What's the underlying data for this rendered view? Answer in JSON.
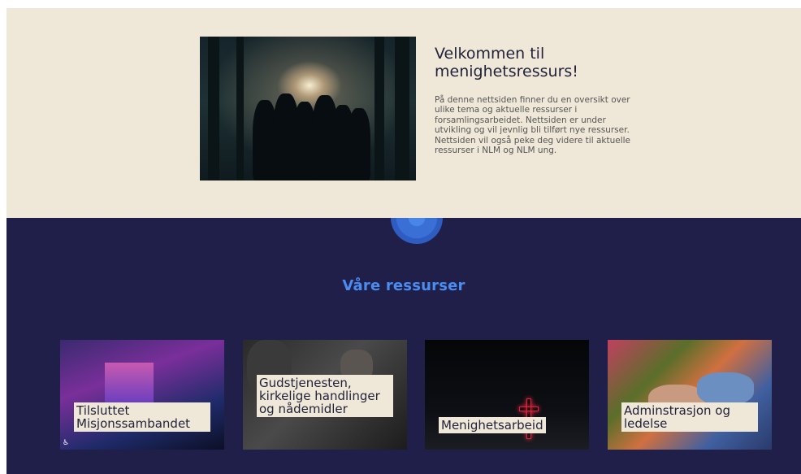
{
  "hero": {
    "title": "Velkommen til menighetsressurs!",
    "body": "På denne nettsiden finner du en oversikt over ulike tema og aktuelle ressurser i forsamlingsarbeidet. Nettsiden er under utvikling og vil jevnlig bli tilført nye ressurser. Nettsiden vil også peke deg videre til aktuelle ressurser i NLM og NLM ung."
  },
  "resources": {
    "title": "Våre ressurser",
    "cards": [
      {
        "label": "Tilsluttet Misjonssambandet"
      },
      {
        "label": "Gudstjenesten, kirkelige handlinger og nådemidler"
      },
      {
        "label": "Menighetsarbeid"
      },
      {
        "label": "Adminstrasjon og ledelse"
      }
    ]
  },
  "icons": {
    "accessibility": "accessibility-icon",
    "scroll": "scroll-down-icon"
  },
  "colors": {
    "hero_bg": "#efe8d8",
    "dark_bg": "#1f1f4a",
    "accent": "#4a8cf0"
  }
}
